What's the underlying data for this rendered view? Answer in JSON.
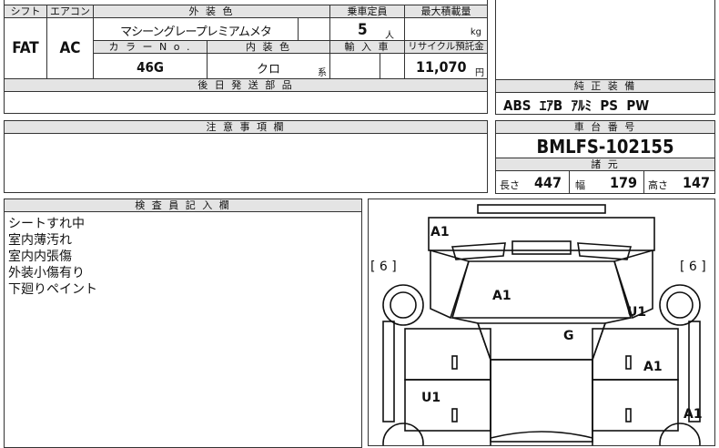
{
  "spec_table": {
    "shift_label": "シフト",
    "ac_label": "エアコン",
    "exterior_color_label": "外 装 色",
    "capacity_label": "乗車定員",
    "max_load_label": "最大積載量",
    "shift_value": "FAT",
    "ac_value": "AC",
    "exterior_color_value": "マシーングレープレミアムメタ",
    "capacity_value": "5",
    "capacity_unit": "人",
    "load_unit": "kg",
    "color_no_label": "カ ラ ー N o .",
    "interior_color_label": "内 装 色",
    "import_label": "輸 入 車",
    "recycle_label": "リサイクル預託金",
    "color_no_value": "46G",
    "interior_color_value": "クロ",
    "interior_suffix": "系",
    "recycle_value": "11,070",
    "recycle_unit": "円",
    "later_parts_label": "後 日 発 送 部 品"
  },
  "equipment": {
    "label": "純 正 装 備",
    "items": "ABS  ｴｱB  ｱﾙﾐ  PS  PW"
  },
  "notes": {
    "label": "注 意 事 項 欄"
  },
  "chassis": {
    "label": "車 台 番 号",
    "number": "BMLFS-102155",
    "dims_label": "諸 元",
    "length_label": "長さ",
    "length_value": "447",
    "width_label": "幅",
    "width_value": "179",
    "height_label": "高さ",
    "height_value": "147"
  },
  "inspector": {
    "label": "検 査 員 記 入 欄",
    "remarks": [
      "シートすれ中",
      "室内薄汚れ",
      "室内内張傷",
      "外装小傷有り",
      "下廻りペイント"
    ]
  },
  "diagram": {
    "tire_left": "[ 6 ]",
    "tire_right": "[ 6 ]",
    "marks": {
      "roof": "A1",
      "hood": "A1",
      "front_right_fender": "U1",
      "windshield": "G",
      "right_front_door": "A1",
      "left_front_door": "U1",
      "right_rear": "A1"
    }
  }
}
